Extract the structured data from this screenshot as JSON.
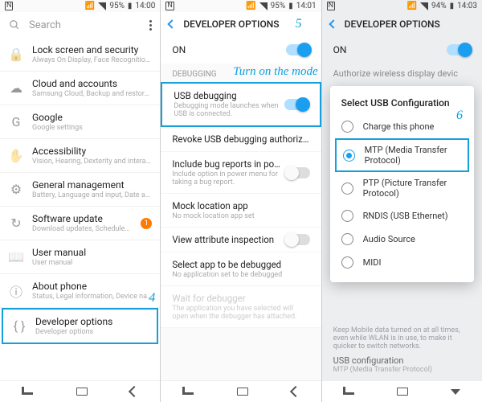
{
  "status": {
    "nfc": "N",
    "wifi": "📶",
    "battery_pct_1": "95%",
    "time_1": "14:00",
    "battery_pct_2": "95%",
    "time_2": "14:01",
    "battery_pct_3": "94%",
    "time_3": "14:03"
  },
  "screen1": {
    "search_placeholder": "Search",
    "items": [
      {
        "icon": "🔒",
        "title": "Lock screen and security",
        "sub": "Always On Display, Face Recognition, Finge..."
      },
      {
        "icon": "☁",
        "title": "Cloud and accounts",
        "sub": "Samsung Cloud, Backup and restore, Smart..."
      },
      {
        "icon": "G",
        "title": "Google",
        "sub": "Google settings"
      },
      {
        "icon": "✋",
        "title": "Accessibility",
        "sub": "Vision, Hearing, Dexterity and interaction"
      },
      {
        "icon": "⚙",
        "title": "General management",
        "sub": "Battery, Language and input, Date and time..."
      },
      {
        "icon": "↻",
        "title": "Software update",
        "sub": "Download updates, Scheduled updates, softl...",
        "badge": "1"
      },
      {
        "icon": "📖",
        "title": "User manual",
        "sub": "User manual"
      },
      {
        "icon": "ⓘ",
        "title": "About phone",
        "sub": "Status, Legal information, Device name"
      },
      {
        "icon": "{ }",
        "title": "Developer options",
        "sub": "Developer options"
      }
    ],
    "anno4": "4"
  },
  "screen2": {
    "title": "DEVELOPER OPTIONS",
    "anno5": "5",
    "on_label": "ON",
    "debug_section": "DEBUGGING",
    "anno_turn": "Turn on the mode",
    "rows": [
      {
        "title": "USB debugging",
        "sub": "Debugging mode launches when USB is connected.",
        "toggle": "on",
        "boxed": true
      },
      {
        "title": "Revoke USB debugging authorizations"
      },
      {
        "title": "Include bug reports in power me..",
        "sub": "Include option in power menu for taking a bug report.",
        "toggle": "off"
      },
      {
        "title": "Mock location app",
        "sub": "No mock location app set"
      },
      {
        "title": "View attribute inspection",
        "toggle": "off"
      },
      {
        "title": "Select app to be debugged",
        "sub": "No application set to be debugged"
      },
      {
        "title": "Wait for debugger",
        "sub": "The application you have selected will open when the debugger has attached.",
        "disabled": true
      }
    ]
  },
  "screen3": {
    "title": "DEVELOPER OPTIONS",
    "on_label": "ON",
    "bg_row1": "Authorize wireless display devic",
    "modal_title": "Select USB Configuration",
    "anno6": "6",
    "options": [
      {
        "label": "Charge this phone"
      },
      {
        "label": "MTP (Media Transfer Protocol)",
        "checked": true,
        "boxed": true
      },
      {
        "label": "PTP (Picture Transfer Protocol)"
      },
      {
        "label": "RNDIS (USB Ethernet)"
      },
      {
        "label": "Audio Source"
      },
      {
        "label": "MIDI"
      }
    ],
    "below_title": "",
    "below_sub": "Keep Mobile data turned on at all times, even while WLAN is in use, to make it quicker to switch networks.",
    "below_t2a": "USB configuration",
    "below_t2b": "MTP (Media Transfer Protocol)"
  }
}
